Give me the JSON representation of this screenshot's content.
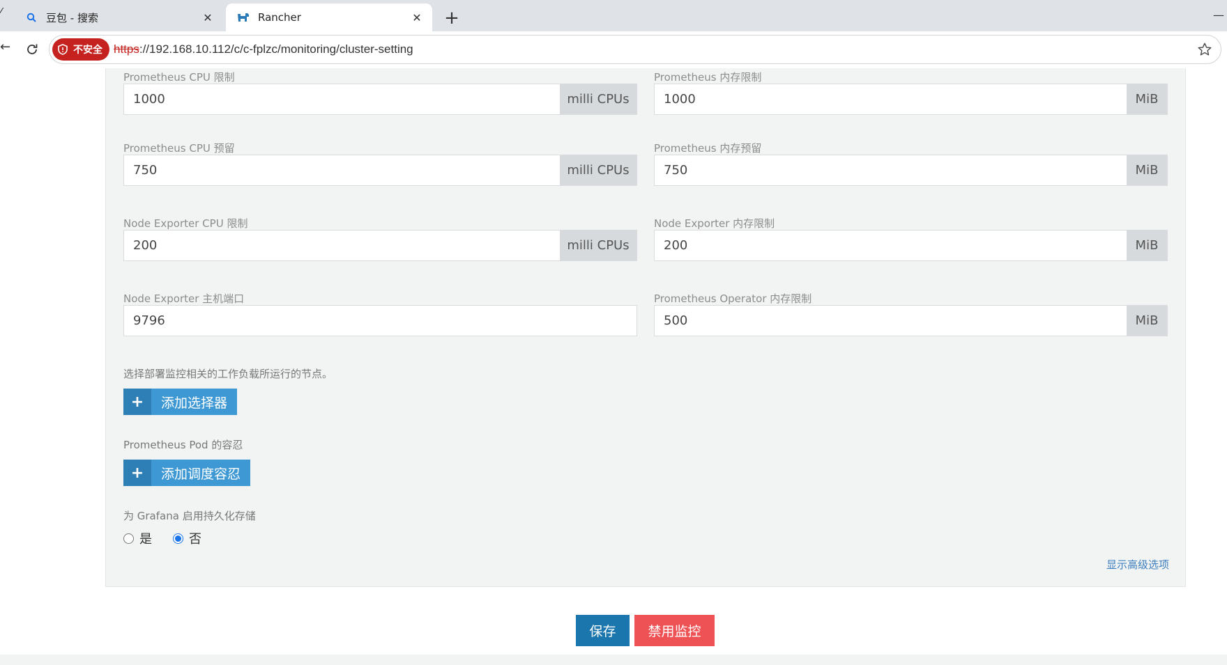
{
  "browser": {
    "tabs": [
      {
        "title": "豆包 - 搜索",
        "icon": "search-icon"
      },
      {
        "title": "Rancher",
        "icon": "rancher-logo-icon"
      }
    ],
    "address": {
      "security_badge": "不安全",
      "protocol": "https",
      "rest": "://192.168.10.112/c/c-fplzc/monitoring/cluster-setting"
    }
  },
  "form": {
    "prometheus_cpu_limit": {
      "label": "Prometheus CPU 限制",
      "value": "1000",
      "unit": "milli CPUs"
    },
    "prometheus_mem_limit": {
      "label": "Prometheus 内存限制",
      "value": "1000",
      "unit": "MiB"
    },
    "prometheus_cpu_reserve": {
      "label": "Prometheus CPU 预留",
      "value": "750",
      "unit": "milli CPUs"
    },
    "prometheus_mem_reserve": {
      "label": "Prometheus 内存预留",
      "value": "750",
      "unit": "MiB"
    },
    "node_exporter_cpu_limit": {
      "label": "Node Exporter CPU 限制",
      "value": "200",
      "unit": "milli CPUs"
    },
    "node_exporter_mem_limit": {
      "label": "Node Exporter 内存限制",
      "value": "200",
      "unit": "MiB"
    },
    "node_exporter_host_port": {
      "label": "Node Exporter 主机端口",
      "value": "9796"
    },
    "operator_mem_limit": {
      "label": "Prometheus Operator 内存限制",
      "value": "500",
      "unit": "MiB"
    },
    "node_selector": {
      "label": "选择部署监控相关的工作负载所运行的节点。",
      "button": "添加选择器"
    },
    "tolerations": {
      "label": "Prometheus Pod 的容忍",
      "button": "添加调度容忍"
    },
    "grafana_persist": {
      "label": "为 Grafana 启用持久化存储",
      "yes": "是",
      "no": "否",
      "selected": "否"
    },
    "advanced_link": "显示高级选项"
  },
  "actions": {
    "save": "保存",
    "disable": "禁用监控"
  },
  "colors": {
    "primary": "#3d98d3",
    "save": "#1b76ae",
    "danger": "#ee5255",
    "insecure": "#c5221f"
  }
}
